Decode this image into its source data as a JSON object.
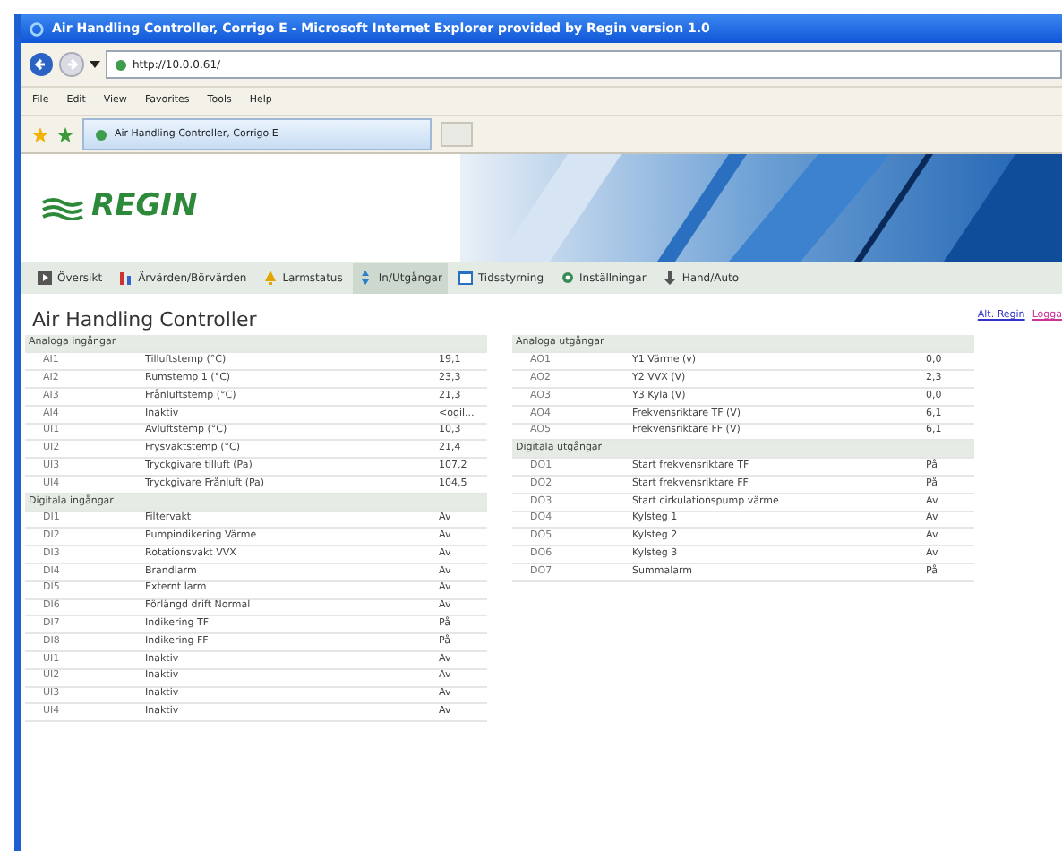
{
  "window": {
    "title": "Air Handling Controller, Corrigo E - Microsoft Internet Explorer provided by Regin version 1.0"
  },
  "address": "http://10.0.0.61/",
  "menu": [
    "File",
    "Edit",
    "View",
    "Favorites",
    "Tools",
    "Help"
  ],
  "browser_tab": "Air Handling Controller, Corrigo E",
  "logo": "REGIN",
  "tabs": [
    {
      "label": "Översikt",
      "kind": "overview",
      "selected": false
    },
    {
      "label": "Ärvärden/Börvärden",
      "kind": "values",
      "selected": false
    },
    {
      "label": "Larmstatus",
      "kind": "alarm",
      "selected": false
    },
    {
      "label": "In/Utgångar",
      "kind": "io",
      "selected": true
    },
    {
      "label": "Tidsstyrning",
      "kind": "calendar",
      "selected": false
    },
    {
      "label": "Inställningar",
      "kind": "settings",
      "selected": false
    },
    {
      "label": "Hand/Auto",
      "kind": "hand",
      "selected": false
    }
  ],
  "heading": "Air Handling Controller",
  "links": [
    "Alt. Regin",
    "Logga"
  ],
  "panels": [
    {
      "sections": [
        {
          "title": "Analoga ingångar",
          "rows": [
            [
              "AI1",
              "Tilluftstemp (°C)",
              "19,1"
            ],
            [
              "AI2",
              "Rumstemp 1 (°C)",
              "23,3"
            ],
            [
              "AI3",
              "Frånluftstemp (°C)",
              "21,3"
            ],
            [
              "AI4",
              "Inaktiv",
              "<ogil..."
            ],
            [
              "UI1",
              "Avluftstemp (°C)",
              "10,3"
            ],
            [
              "UI2",
              "Frysvaktstemp (°C)",
              "21,4"
            ],
            [
              "UI3",
              "Tryckgivare tilluft (Pa)",
              "107,2"
            ],
            [
              "UI4",
              "Tryckgivare Frånluft (Pa)",
              "104,5"
            ]
          ]
        },
        {
          "title": "Digitala ingångar",
          "rows": [
            [
              "DI1",
              "Filtervakt",
              "Av"
            ],
            [
              "DI2",
              "Pumpindikering Värme",
              "Av"
            ],
            [
              "DI3",
              "Rotationsvakt VVX",
              "Av"
            ],
            [
              "DI4",
              "Brandlarm",
              "Av"
            ],
            [
              "DI5",
              "Externt larm",
              "Av"
            ],
            [
              "DI6",
              "Förlängd drift Normal",
              "Av"
            ],
            [
              "DI7",
              "Indikering TF",
              "På"
            ],
            [
              "DI8",
              "Indikering FF",
              "På"
            ],
            [
              "UI1",
              "Inaktiv",
              "Av"
            ],
            [
              "UI2",
              "Inaktiv",
              "Av"
            ],
            [
              "UI3",
              "Inaktiv",
              "Av"
            ],
            [
              "UI4",
              "Inaktiv",
              "Av"
            ]
          ]
        }
      ]
    },
    {
      "sections": [
        {
          "title": "Analoga utgångar",
          "rows": [
            [
              "AO1",
              "Y1 Värme (v)",
              "0,0"
            ],
            [
              "AO2",
              "Y2 VVX (V)",
              "2,3"
            ],
            [
              "AO3",
              "Y3 Kyla (V)",
              "0,0"
            ],
            [
              "AO4",
              "Frekvensriktare TF (V)",
              "6,1"
            ],
            [
              "AO5",
              "Frekvensriktare FF (V)",
              "6,1"
            ]
          ]
        },
        {
          "title": "Digitala utgångar",
          "rows": [
            [
              "DO1",
              "Start frekvensriktare TF",
              "På"
            ],
            [
              "DO2",
              "Start frekvensriktare FF",
              "På"
            ],
            [
              "DO3",
              "Start cirkulationspump värme",
              "Av"
            ],
            [
              "DO4",
              "Kylsteg 1",
              "Av"
            ],
            [
              "DO5",
              "Kylsteg 2",
              "Av"
            ],
            [
              "DO6",
              "Kylsteg 3",
              "Av"
            ],
            [
              "DO7",
              "Summalarm",
              "På"
            ]
          ]
        }
      ]
    }
  ]
}
